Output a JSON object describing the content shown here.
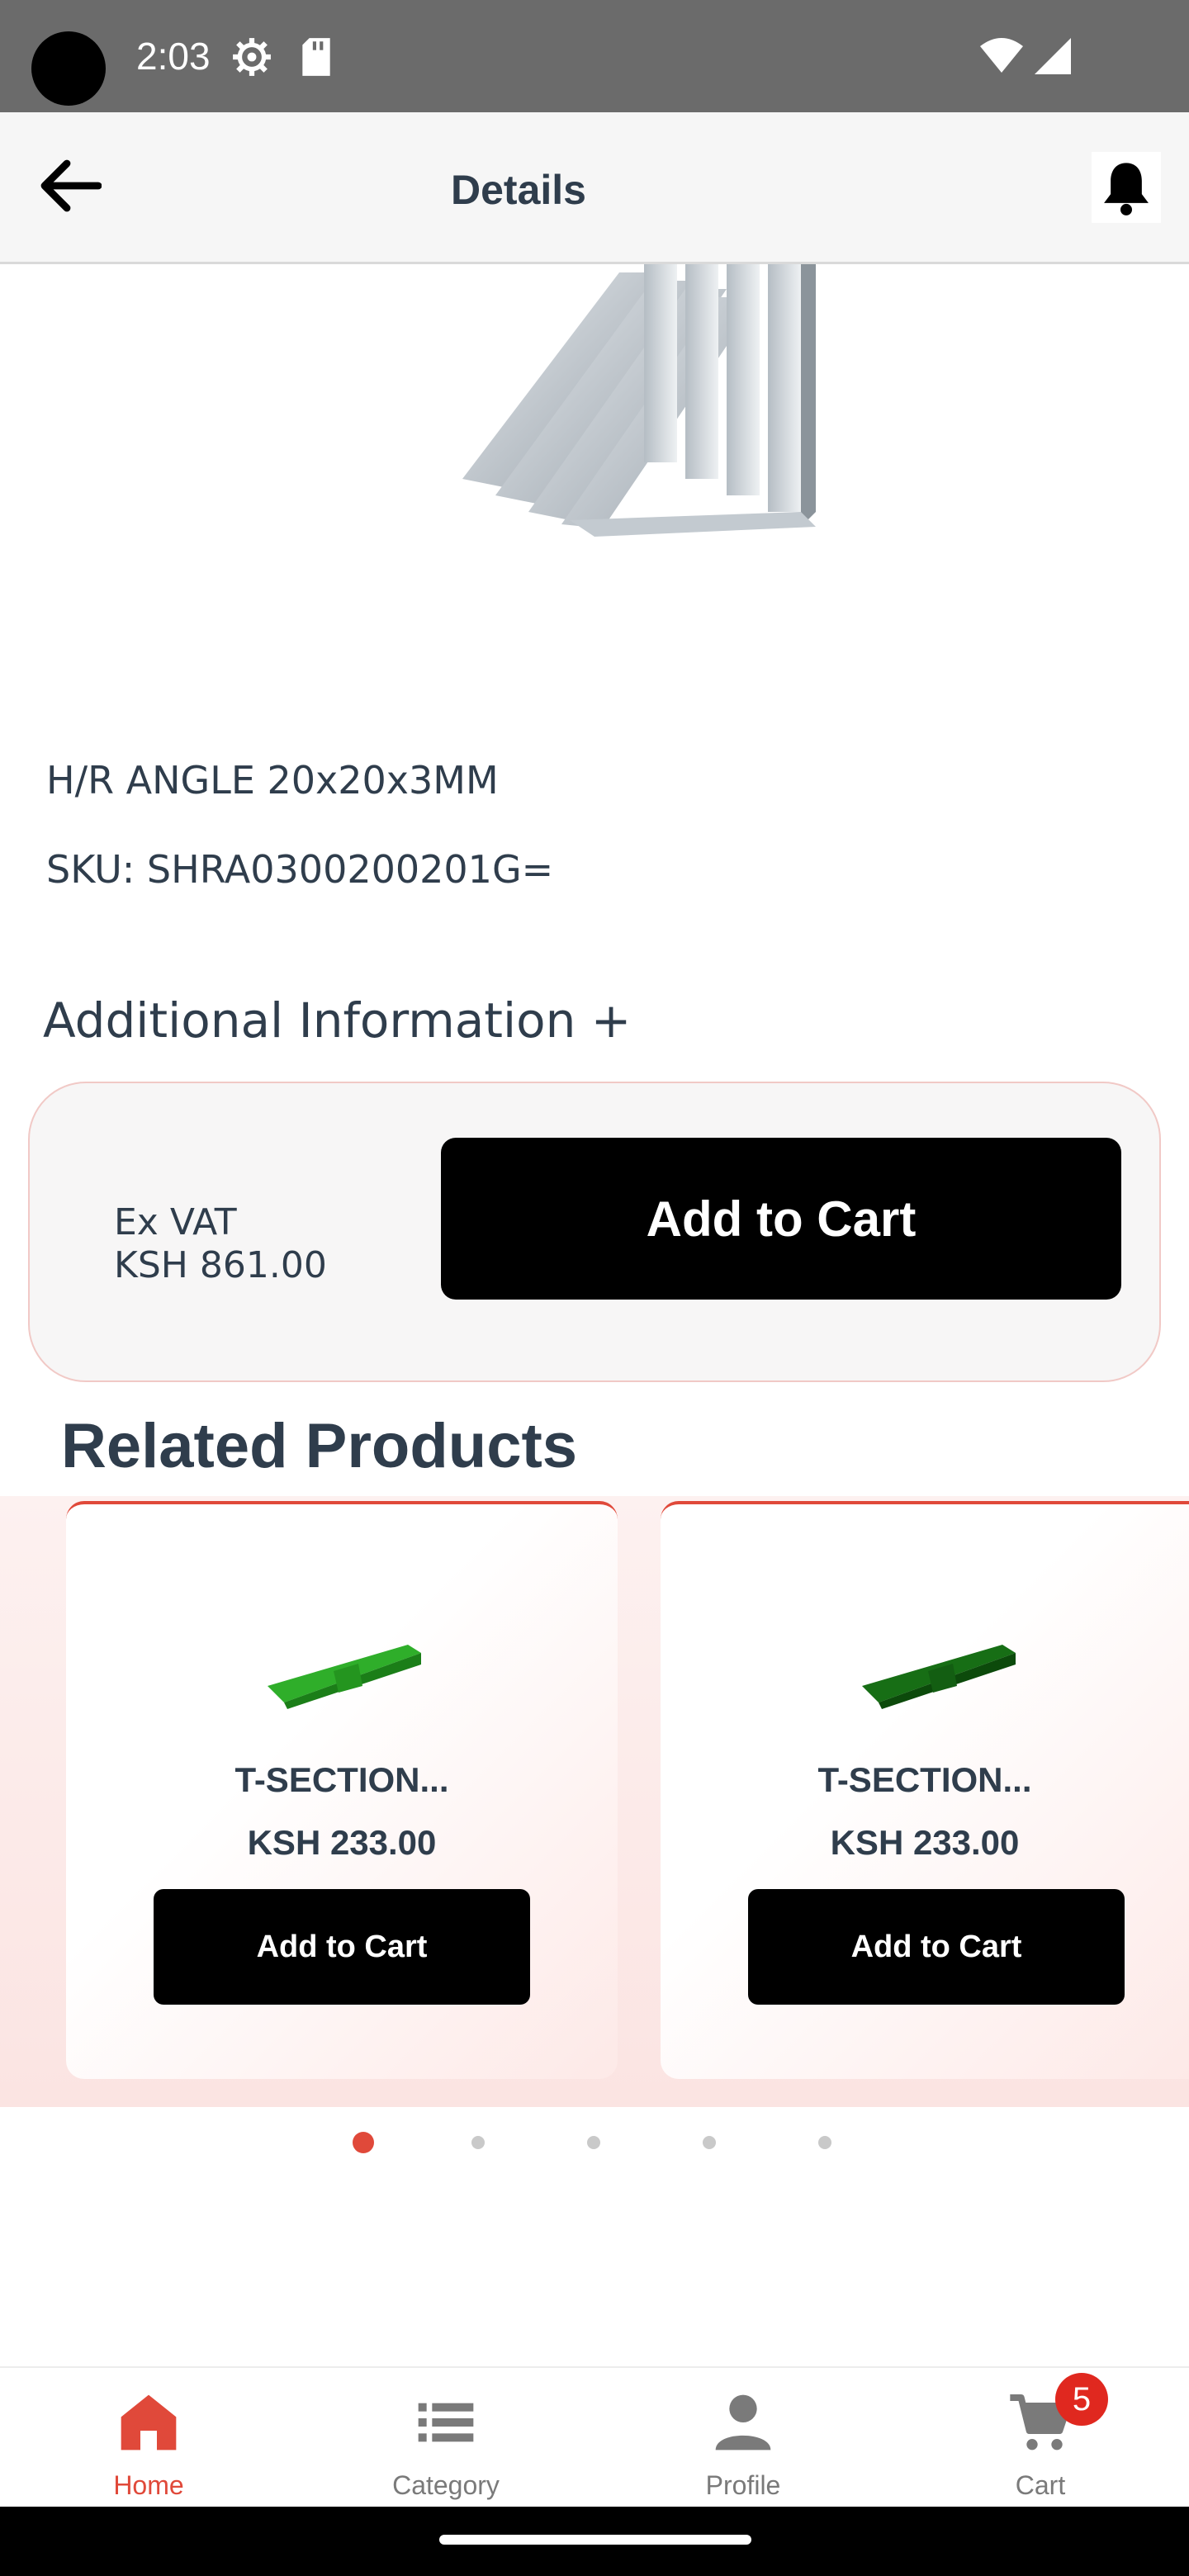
{
  "status_bar": {
    "time": "2:03"
  },
  "header": {
    "title": "Details"
  },
  "product": {
    "name": "H/R ANGLE 20x20x3MM",
    "sku": "SKU: SHRA0300200201G=",
    "additional_info": "Additional Information +",
    "vat_label": "Ex VAT",
    "price": "KSH 861.00",
    "add_to_cart_label": "Add to Cart"
  },
  "related": {
    "title": "Related Products",
    "items": [
      {
        "name": "T-SECTION...",
        "price": "KSH 233.00",
        "button": "Add to Cart"
      },
      {
        "name": "T-SECTION...",
        "price": "KSH 233.00",
        "button": "Add to Cart"
      }
    ],
    "pagination": {
      "pages": 5,
      "active": 1
    }
  },
  "bottom_nav": {
    "items": [
      {
        "label": "Home",
        "icon": "home-icon",
        "active": true
      },
      {
        "label": "Category",
        "icon": "list-icon",
        "active": false
      },
      {
        "label": "Profile",
        "icon": "person-icon",
        "active": false
      },
      {
        "label": "Cart",
        "icon": "cart-icon",
        "active": false
      }
    ],
    "cart_count": "5"
  },
  "colors": {
    "accent": "#e0493a",
    "text": "#2f3d4c",
    "badge": "#e0281f"
  }
}
